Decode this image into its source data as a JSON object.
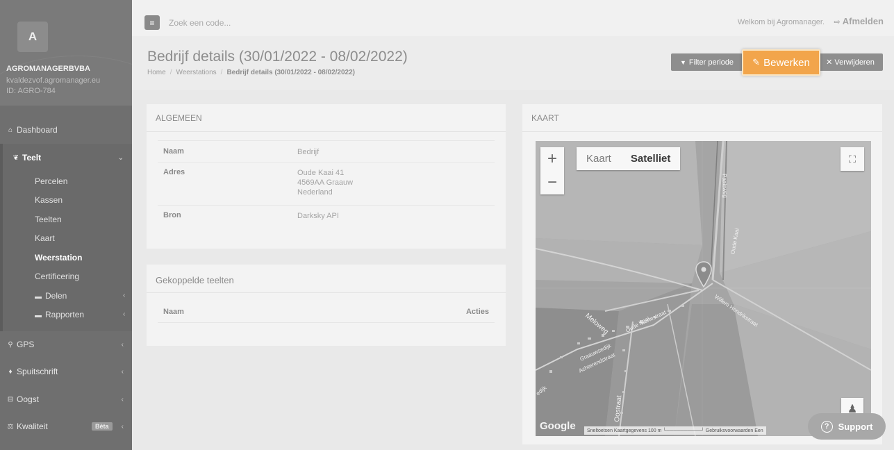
{
  "sidebar": {
    "avatar_letter": "A",
    "company": "AGROMANAGERBVBA",
    "email": "kvaldezvof.agromanager.eu",
    "id": "ID: AGRO-784",
    "dashboard": "Dashboard",
    "teelt": "Teelt",
    "teelt_items": [
      "Percelen",
      "Kassen",
      "Teelten",
      "Kaart",
      "Weerstation",
      "Certificering"
    ],
    "delen": "Delen",
    "rapporten": "Rapporten",
    "gps": "GPS",
    "spuitschrift": "Spuitschrift",
    "oogst": "Oogst",
    "kwaliteit": "Kwaliteit",
    "beta": "Bèta"
  },
  "topbar": {
    "search_placeholder": "Zoek een code...",
    "welcome": "Welkom bij Agromanager.",
    "logout": "Afmelden"
  },
  "header": {
    "title": "Bedrijf details (30/01/2022 - 08/02/2022)",
    "breadcrumb": [
      "Home",
      "Weerstations",
      "Bedrijf details (30/01/2022 - 08/02/2022)"
    ],
    "filter_button": "Filter periode",
    "edit_button": "Bewerken",
    "delete_button": "Verwijderen"
  },
  "algemeen": {
    "title": "ALGEMEEN",
    "naam_label": "Naam",
    "naam_value": "Bedrijf",
    "adres_label": "Adres",
    "adres_lines": [
      "Oude Kaai 41",
      "4569AA Graauw",
      "Nederland"
    ],
    "bron_label": "Bron",
    "bron_value": "Darksky API"
  },
  "gekoppelde": {
    "title": "Gekoppelde teelten",
    "col_naam": "Naam",
    "col_acties": "Acties"
  },
  "kaart": {
    "title": "KAART",
    "type_kaart": "Kaart",
    "type_satelliet": "Satelliet",
    "google": "Google",
    "attribution": "Sneltoetsen   Kaartgegevens   100 m └──────────┘   Gebruiksvoorwaarden   Een",
    "roads": [
      "Paalsweg",
      "Oude Kaai",
      "Willem Hendrikstraat",
      "Meloweg",
      "Oude Kaai",
      "Kortestraat",
      "Graauwsedijk",
      "Achterendstraat",
      "Oostraat",
      "edijk"
    ]
  },
  "support": "Support"
}
